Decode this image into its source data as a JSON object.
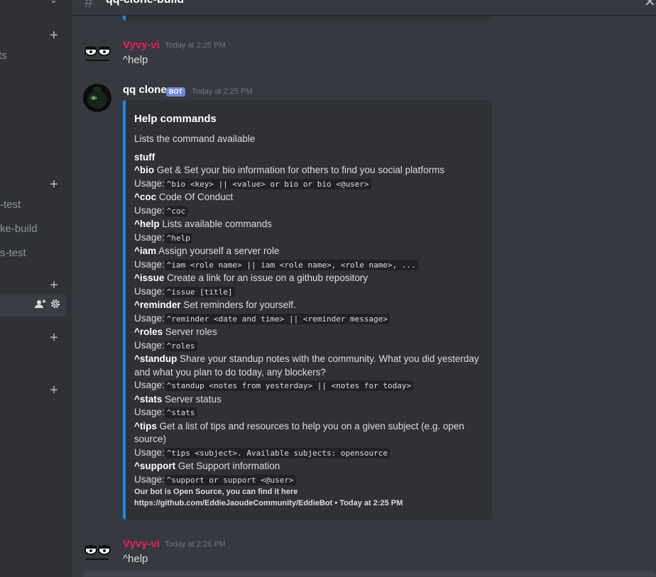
{
  "sidebar": {
    "channels": [
      "ts",
      "-test",
      "ke-build",
      "s-test"
    ]
  },
  "header": {
    "channel_name": "qq-clone-build"
  },
  "colors": {
    "accent": "#1e88e5",
    "vyvy_name": "#e91e63",
    "bot_tag": "#7289da"
  },
  "messages": [
    {
      "author": "Vyvy-vi",
      "time": "Today at 2:25 PM",
      "text": "^help"
    },
    {
      "author": "qq clone",
      "bot_tag": "BOT",
      "time": "Today at 2:25 PM"
    },
    {
      "author": "Vyvy-vi",
      "time": "Today at 2:26 PM",
      "text": "^help"
    }
  ],
  "embed": {
    "title": "Help commands",
    "description": "Lists the command available",
    "field_name": "stuff",
    "commands": [
      {
        "cmd": "^bio",
        "desc": "Get & Set your bio information for others to find you social platforms",
        "usage": "^bio <key> || <value> or bio or bio <@user>"
      },
      {
        "cmd": "^coc",
        "desc": "Code Of Conduct",
        "usage": "^coc"
      },
      {
        "cmd": "^help",
        "desc": "Lists available commands",
        "usage": "^help"
      },
      {
        "cmd": "^iam",
        "desc": "Assign yourself a server role",
        "usage": "^iam <role name> || iam <role name>, <role name>, ..."
      },
      {
        "cmd": "^issue",
        "desc": "Create a link for an issue on a github repository",
        "usage": "^issue [title]"
      },
      {
        "cmd": "^reminder",
        "desc": "Set reminders for yourself.",
        "usage": "^reminder <date and time> || <reminder message>"
      },
      {
        "cmd": "^roles",
        "desc": "Server roles",
        "usage": "^roles"
      },
      {
        "cmd": "^standup",
        "desc": "Share your standup notes with the community. What you did yesterday and what you plan to do today, any blockers?",
        "usage": "^standup <notes from yesterday> || <notes for today>"
      },
      {
        "cmd": "^stats",
        "desc": "Server status",
        "usage": "^stats"
      },
      {
        "cmd": "^tips",
        "desc": "Get a list of tips and resources to help you on a given subject (e.g. open source)",
        "usage": "^tips <subject>. Available subjects: opensource"
      },
      {
        "cmd": "^support",
        "desc": "Get Support information",
        "usage": "^support or support <@user>"
      }
    ],
    "usage_label": "Usage:",
    "footer_line1": "Our bot is Open Source, you can find it here",
    "footer_line2": "https://github.com/EddieJaoudeCommunity/EddieBot",
    "footer_sep": "•",
    "footer_time": "Today at 2:25 PM"
  }
}
